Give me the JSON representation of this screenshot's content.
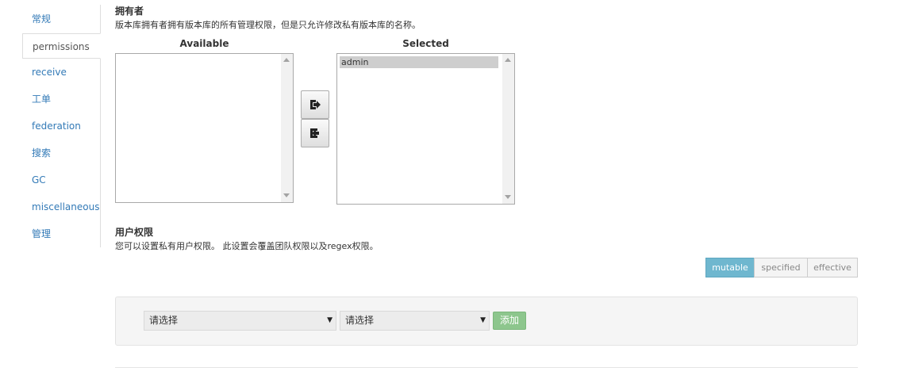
{
  "sidebar": {
    "items": [
      {
        "label": "常规"
      },
      {
        "label": "permissions"
      },
      {
        "label": "receive"
      },
      {
        "label": "工单"
      },
      {
        "label": "federation"
      },
      {
        "label": "搜索"
      },
      {
        "label": "GC"
      },
      {
        "label": "miscellaneous"
      },
      {
        "label": "管理"
      }
    ],
    "active": "permissions"
  },
  "owner": {
    "title": "拥有者",
    "description": "版本库拥有者拥有版本库的所有管理权限，但是只允许修改私有版本库的名称。",
    "available_label": "Available",
    "selected_label": "Selected",
    "available_items": [],
    "selected_items": [
      "admin"
    ]
  },
  "user_permissions": {
    "title": "用户权限",
    "description": "您可以设置私有用户权限。 此设置会覆盖团队权限以及regex权限。",
    "modes": [
      "mutable",
      "specified",
      "effective"
    ],
    "active_mode": "mutable",
    "user_select": "请选择",
    "permission_select": "请选择",
    "add_label": "添加"
  },
  "icons": {
    "move_right": "arrow-right-icon",
    "move_left": "arrow-left-icon",
    "dropdown": "caret-down-icon"
  },
  "colors": {
    "link": "#337ab7",
    "toggle_active": "#6fb7cf",
    "add_button": "#8dc68d",
    "selected_option": "#cecece"
  }
}
